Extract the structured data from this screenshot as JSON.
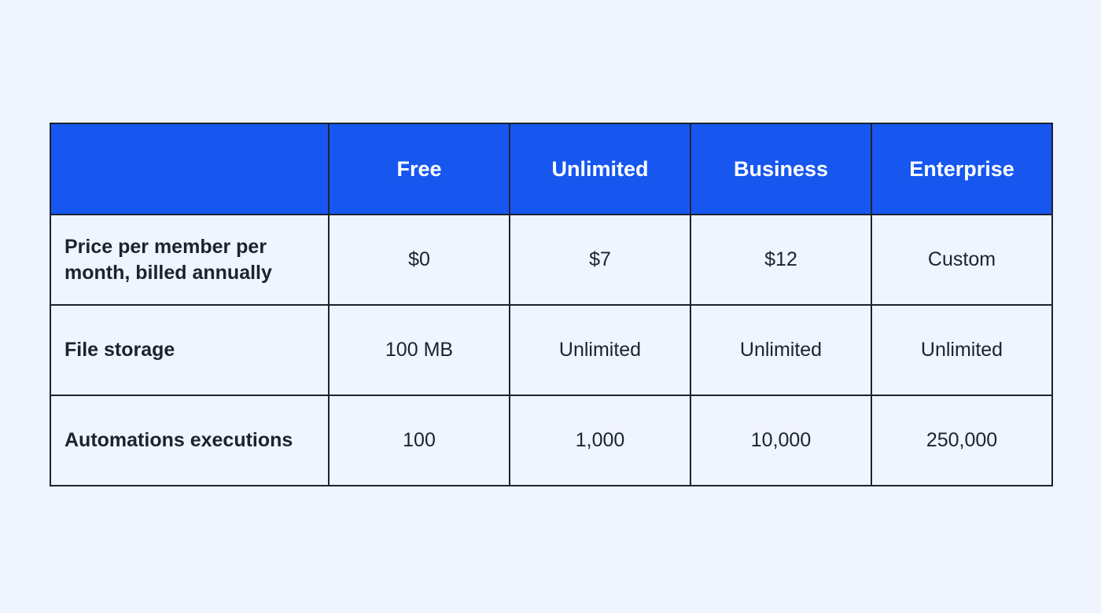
{
  "table": {
    "header": {
      "corner": "",
      "plans": [
        "Free",
        "Unlimited",
        "Business",
        "Enterprise"
      ]
    },
    "rows": [
      {
        "feature": "Price per member per month, billed annually",
        "values": [
          "$0",
          "$7",
          "$12",
          "Custom"
        ]
      },
      {
        "feature": "File storage",
        "values": [
          "100 MB",
          "Unlimited",
          "Unlimited",
          "Unlimited"
        ]
      },
      {
        "feature": "Automations executions",
        "values": [
          "100",
          "1,000",
          "10,000",
          "250,000"
        ]
      }
    ]
  },
  "colors": {
    "header_bg": "#1757f0",
    "header_text": "#ffffff",
    "page_bg": "#eff4ff",
    "border": "#1b2230",
    "text": "#1b2230"
  }
}
